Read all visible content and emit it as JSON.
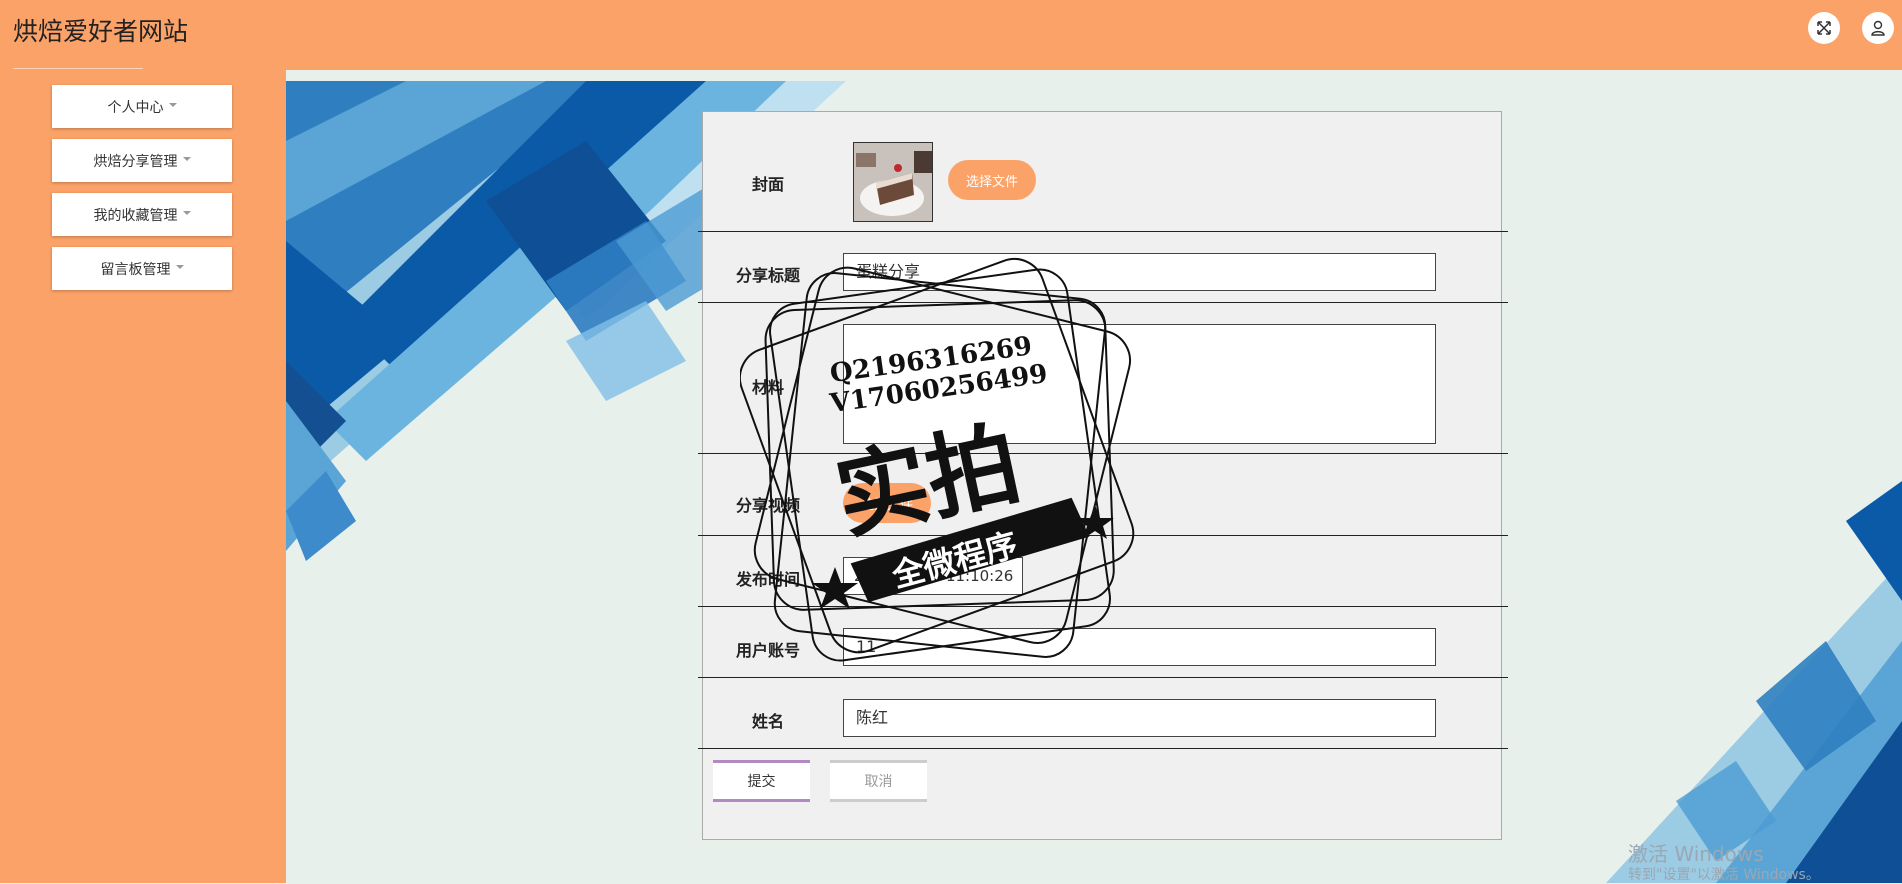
{
  "header": {
    "site_title": "烘焙爱好者网站",
    "fullscreen_icon": "expand-arrows-icon",
    "user_icon": "user-icon"
  },
  "sidebar": {
    "items": [
      {
        "label": "个人中心"
      },
      {
        "label": "烘焙分享管理"
      },
      {
        "label": "我的收藏管理"
      },
      {
        "label": "留言板管理"
      }
    ]
  },
  "form": {
    "cover": {
      "label": "封面",
      "choose_file": "选择文件"
    },
    "share_title": {
      "label": "分享标题",
      "value": "蛋糕分享"
    },
    "ingredients": {
      "label": "材料",
      "value": ""
    },
    "share_video": {
      "label": "分享视频",
      "choose_file": "选择文件"
    },
    "publish_time": {
      "label": "发布时间",
      "value": "2022-03-29 11:10:26"
    },
    "user_account": {
      "label": "用户账号",
      "value": "11"
    },
    "name": {
      "label": "姓名",
      "value": "陈红"
    },
    "submit": "提交",
    "cancel": "取消"
  },
  "stamp": {
    "line1": "Q2196316269",
    "line2": "V17060256499",
    "big_text": "实拍",
    "ribbon": "全微程序"
  },
  "os_watermark": {
    "line1": "激活 Windows",
    "line2": "转到\"设置\"以激活 Windows。"
  },
  "colors": {
    "header_bg": "#fba268",
    "accent": "#fba268",
    "page_bg": "#e8f0ec",
    "form_bg": "#f0f0f0"
  }
}
